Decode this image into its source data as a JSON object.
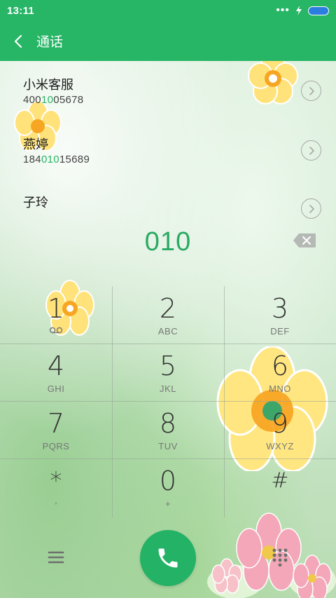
{
  "status_bar": {
    "time": "13:11",
    "more": "•••",
    "colors": {
      "bar": "#27b566",
      "battery": "#2b7ee0"
    }
  },
  "header": {
    "back_icon": "chevron-left-icon",
    "title": "通话"
  },
  "contacts": [
    {
      "name": "小米客服",
      "number_pre": "400",
      "number_match": "10",
      "number_post": "05678"
    },
    {
      "name": "燕婷",
      "number_pre": "184",
      "number_match": "010",
      "number_post": "15689"
    },
    {
      "name": "子玲",
      "number_pre": "",
      "number_match": "",
      "number_post": ""
    }
  ],
  "dialer": {
    "input": "010",
    "accent_color": "#2aaa63"
  },
  "keypad": [
    {
      "digit": "1",
      "letters": ""
    },
    {
      "digit": "2",
      "letters": "ABC"
    },
    {
      "digit": "3",
      "letters": "DEF"
    },
    {
      "digit": "4",
      "letters": "GHI"
    },
    {
      "digit": "5",
      "letters": "JKL"
    },
    {
      "digit": "6",
      "letters": "MNO"
    },
    {
      "digit": "7",
      "letters": "PQRS"
    },
    {
      "digit": "8",
      "letters": "TUV"
    },
    {
      "digit": "9",
      "letters": "WXYZ"
    },
    {
      "digit": "*",
      "letters": ","
    },
    {
      "digit": "0",
      "letters": "+"
    },
    {
      "digit": "#",
      "letters": ""
    }
  ],
  "bottom_bar": {
    "menu_icon": "menu-icon",
    "call_icon": "phone-icon",
    "dialpad_icon": "dialpad-icon",
    "call_color": "#23b266"
  }
}
